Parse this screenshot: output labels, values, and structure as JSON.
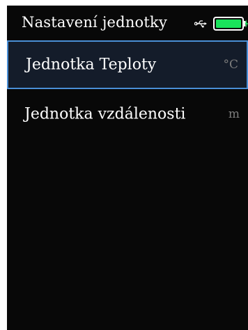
{
  "status_bar": {
    "title": "Nastavení jednotky",
    "usb_icon": "usb-icon",
    "battery_icon": "battery-charging-icon",
    "battery_level": 1.0,
    "battery_color": "#19e35b"
  },
  "menu": {
    "items": [
      {
        "label": "Jednotka Teploty",
        "value": "°C",
        "selected": true
      },
      {
        "label": "Jednotka vzdálenosti",
        "value": "m",
        "selected": false
      }
    ]
  },
  "colors": {
    "background": "#080808",
    "selected_background": "#141c2a",
    "selected_border": "#4a8fd6",
    "text": "#ffffff",
    "value_text": "#7d7d7d"
  }
}
